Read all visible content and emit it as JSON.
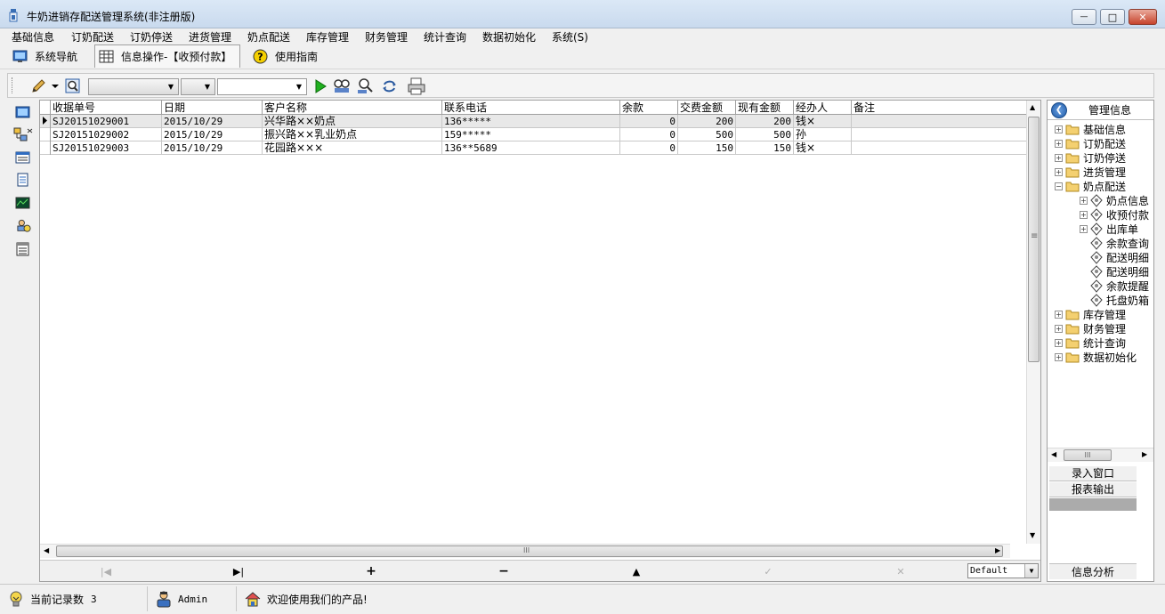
{
  "window": {
    "title": "牛奶进销存配送管理系统(非注册版)",
    "minimize_glyph": "—",
    "maximize_glyph": "□",
    "close_glyph": "✕"
  },
  "menu": [
    "基础信息",
    "订奶配送",
    "订奶停送",
    "进货管理",
    "奶点配送",
    "库存管理",
    "财务管理",
    "统计查询",
    "数据初始化",
    "系统(S)"
  ],
  "tabs": [
    {
      "label": "系统导航",
      "icon": "monitor-icon"
    },
    {
      "label": "信息操作-【收预付款】",
      "icon": "grid-icon",
      "active": true
    },
    {
      "label": "使用指南",
      "icon": "help-icon"
    }
  ],
  "toolbar": {
    "combo1_value": "",
    "combo2_value": "",
    "combo3_value": "",
    "icons": [
      "pencil-icon",
      "dropdown-arrow-icon",
      "search-icon",
      "run-icon",
      "find-user-icon",
      "find-next-icon",
      "refresh-icon",
      "print-icon"
    ]
  },
  "left_icons": [
    "screen-icon",
    "network-icon",
    "list-icon",
    "document-icon",
    "chart-icon",
    "users-icon",
    "table-icon"
  ],
  "grid": {
    "columns": [
      "收据单号",
      "日期",
      "客户名称",
      "联系电话",
      "余款",
      "交费金额",
      "现有金额",
      "经办人",
      "备注"
    ],
    "rows": [
      [
        "SJ20151029001",
        "2015/10/29",
        "兴华路××奶点",
        "136*****",
        "0",
        "200",
        "200",
        "钱×",
        ""
      ],
      [
        "SJ20151029002",
        "2015/10/29",
        "振兴路××乳业奶点",
        "159*****",
        "0",
        "500",
        "500",
        "孙",
        ""
      ],
      [
        "SJ20151029003",
        "2015/10/29",
        "花园路×××",
        "136**5689",
        "0",
        "150",
        "150",
        "钱×",
        ""
      ]
    ],
    "selected_row": 0,
    "hscroll_glyph": "III",
    "vscroll_glyph": "≡"
  },
  "navigator": {
    "buttons": [
      {
        "name": "first-record-button",
        "glyph": "|◀",
        "enabled": false
      },
      {
        "name": "last-record-button",
        "glyph": "▶|",
        "enabled": true
      },
      {
        "name": "add-record-button",
        "glyph": "+",
        "enabled": true
      },
      {
        "name": "delete-record-button",
        "glyph": "−",
        "enabled": true
      },
      {
        "name": "edit-record-button",
        "glyph": "▲",
        "enabled": true
      },
      {
        "name": "post-record-button",
        "glyph": "✓",
        "enabled": false
      },
      {
        "name": "cancel-record-button",
        "glyph": "✕",
        "enabled": false
      }
    ],
    "layout_combo": "Default"
  },
  "right_panel": {
    "header": "管理信息",
    "tree": [
      {
        "label": "基础信息",
        "level": 0,
        "type": "folder",
        "expander": "+"
      },
      {
        "label": "订奶配送",
        "level": 0,
        "type": "folder",
        "expander": "+"
      },
      {
        "label": "订奶停送",
        "level": 0,
        "type": "folder",
        "expander": "+"
      },
      {
        "label": "进货管理",
        "level": 0,
        "type": "folder",
        "expander": "+"
      },
      {
        "label": "奶点配送",
        "level": 0,
        "type": "folder",
        "expander": "−"
      },
      {
        "label": "奶点信息",
        "level": 1,
        "type": "leaf",
        "expander": "+"
      },
      {
        "label": "收预付款",
        "level": 1,
        "type": "leaf",
        "expander": "+"
      },
      {
        "label": "出库单",
        "level": 1,
        "type": "leaf",
        "expander": "+"
      },
      {
        "label": "余款查询",
        "level": 1,
        "type": "leaf",
        "expander": ""
      },
      {
        "label": "配送明细",
        "level": 1,
        "type": "leaf",
        "expander": ""
      },
      {
        "label": "配送明细",
        "level": 1,
        "type": "leaf",
        "expander": ""
      },
      {
        "label": "余款提醒",
        "level": 1,
        "type": "leaf",
        "expander": ""
      },
      {
        "label": "托盘奶箱",
        "level": 1,
        "type": "leaf",
        "expander": ""
      },
      {
        "label": "库存管理",
        "level": 0,
        "type": "folder",
        "expander": "+"
      },
      {
        "label": "财务管理",
        "level": 0,
        "type": "folder",
        "expander": "+"
      },
      {
        "label": "统计查询",
        "level": 0,
        "type": "folder",
        "expander": "+"
      },
      {
        "label": "数据初始化",
        "level": 0,
        "type": "folder",
        "expander": "+"
      }
    ],
    "buttons": [
      "录入窗口",
      "报表输出"
    ],
    "bottom_button": "信息分析",
    "hscroll_glyph": "III"
  },
  "status": {
    "records_label": "当前记录数",
    "records_count": "3",
    "user": "Admin",
    "welcome": "欢迎使用我们的产品!"
  }
}
